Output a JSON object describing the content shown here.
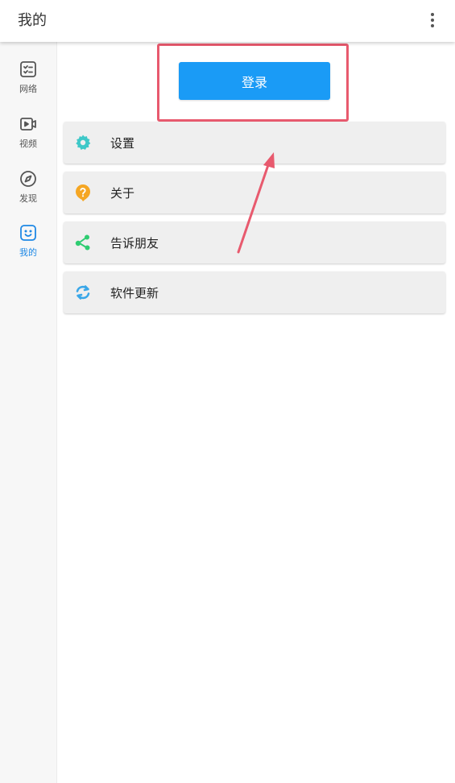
{
  "appbar": {
    "title": "我的"
  },
  "rail": {
    "items": [
      {
        "label": "网络",
        "icon": "checklist-icon"
      },
      {
        "label": "视频",
        "icon": "video-icon"
      },
      {
        "label": "发现",
        "icon": "compass-icon"
      },
      {
        "label": "我的",
        "icon": "smiley-icon"
      }
    ],
    "active": "我的"
  },
  "login": {
    "label": "登录"
  },
  "menu": {
    "items": [
      {
        "label": "设置",
        "icon": "gear-icon",
        "color": "#3ec8c8"
      },
      {
        "label": "关于",
        "icon": "question-icon",
        "color": "#f5a623"
      },
      {
        "label": "告诉朋友",
        "icon": "share-icon",
        "color": "#2ecc71"
      },
      {
        "label": "软件更新",
        "icon": "refresh-icon",
        "color": "#3aa7e8"
      }
    ]
  },
  "colors": {
    "accent": "#1a9bf6",
    "highlight": "#e85a6e",
    "rail_active": "#1e88e5"
  }
}
